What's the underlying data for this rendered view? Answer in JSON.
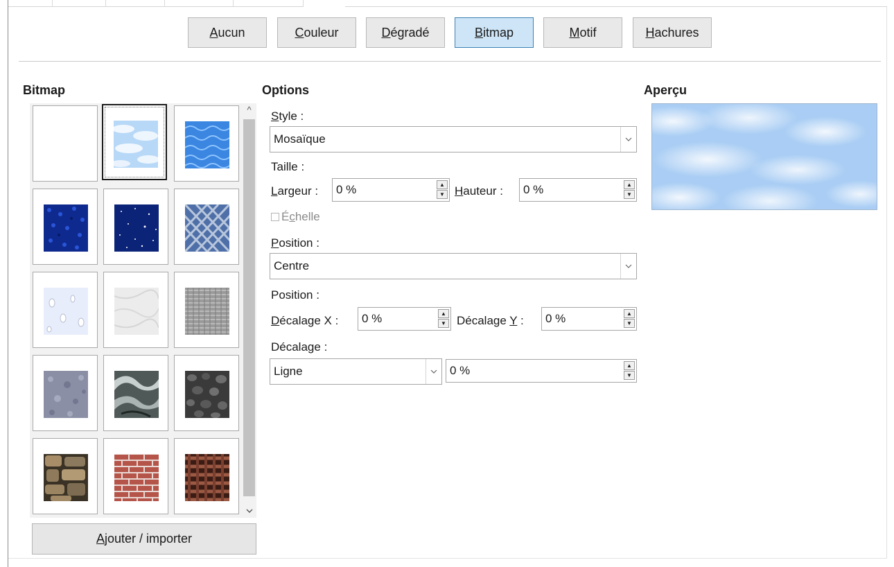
{
  "fill_buttons": [
    {
      "pre": "",
      "ul": "A",
      "post": "ucun"
    },
    {
      "pre": "",
      "ul": "C",
      "post": "ouleur"
    },
    {
      "pre": "",
      "ul": "D",
      "post": "égradé"
    },
    {
      "pre": "",
      "ul": "B",
      "post": "itmap"
    },
    {
      "pre": "",
      "ul": "M",
      "post": "otif"
    },
    {
      "pre": "",
      "ul": "H",
      "post": "achures"
    }
  ],
  "active_fill_button": "Bitmap",
  "bitmap_section": {
    "title": "Bitmap",
    "tiles": [
      "Vide",
      "Ciel",
      "Eau",
      "Gravier bleu",
      "Étoiles",
      "Tissage bleu",
      "Gouttes",
      "Marbre",
      "Toile",
      "Pierre grise",
      "Métal",
      "Galets",
      "Pierres",
      "Briques",
      "Panier"
    ],
    "selected_tile": "Ciel",
    "add_button": {
      "pre": "",
      "ul": "A",
      "post": "jouter / importer"
    }
  },
  "options": {
    "title": "Options",
    "style_label": {
      "pre": "",
      "ul": "S",
      "post": "tyle :"
    },
    "style_value": "Mosaïque",
    "size_label": "Taille :",
    "width_label": {
      "pre": "",
      "ul": "L",
      "post": "argeur :"
    },
    "width_value": "0 %",
    "height_label": {
      "pre": "",
      "ul": "H",
      "post": "auteur :"
    },
    "height_value": "0 %",
    "scale_label": {
      "pre": "É",
      "ul": "c",
      "post": "helle"
    },
    "position_label": {
      "pre": "",
      "ul": "P",
      "post": "osition :"
    },
    "position_value": "Centre",
    "position2_label": "Position :",
    "offset_x_label": {
      "pre": "",
      "ul": "D",
      "post": "écalage X :"
    },
    "offset_x_value": "0 %",
    "offset_y_label": {
      "pre": "Décalage ",
      "ul": "Y",
      "post": " :"
    },
    "offset_y_value": "0 %",
    "offset_label": {
      "pre": "Décala",
      "ul": "g",
      "post": "e :"
    },
    "offset_type_value": "Ligne",
    "offset_value": "0 %"
  },
  "preview": {
    "title": "Aperçu"
  },
  "colors": {
    "active_button_bg": "#cde5f7",
    "active_button_border": "#3c7fb1",
    "preview_sky": "#a9cdf4"
  },
  "icons": {
    "dropdown": "chevron-down-icon",
    "spin_up": "caret-up-icon",
    "spin_down": "caret-down-icon",
    "scroll_up": "chevron-up-icon",
    "scroll_down": "chevron-down-icon"
  }
}
